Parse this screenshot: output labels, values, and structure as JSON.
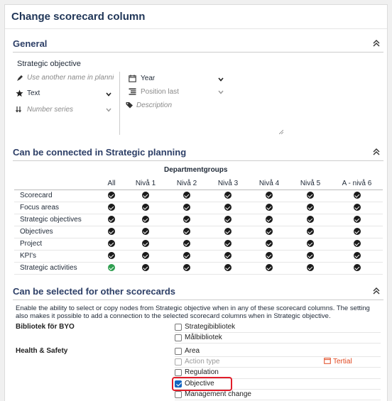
{
  "dialog": {
    "title": "Change scorecard column"
  },
  "general": {
    "heading": "General",
    "name_value": "Strategic objective",
    "alt_name_placeholder": "Use another name in planning",
    "type_value": "Text",
    "number_series_placeholder": "Number series",
    "period_value": "Year",
    "position_placeholder": "Position last",
    "description_placeholder": "Description"
  },
  "connect": {
    "heading": "Can be connected in Strategic planning",
    "group_header": "Departmentgroups",
    "columns": [
      "All",
      "Nivå 1",
      "Nivå 2",
      "Nivå 3",
      "Nivå 4",
      "Nivå 5",
      "A - nivå 6"
    ],
    "rows": [
      {
        "label": "Scorecard",
        "all_green": false
      },
      {
        "label": "Focus areas",
        "all_green": false
      },
      {
        "label": "Strategic objectives",
        "all_green": false
      },
      {
        "label": "Objectives",
        "all_green": false
      },
      {
        "label": "Project",
        "all_green": false
      },
      {
        "label": "KPI's",
        "all_green": false
      },
      {
        "label": "Strategic activities",
        "all_green": true
      }
    ]
  },
  "select": {
    "heading": "Can be selected for other scorecards",
    "description": "Enable the ability to select or copy nodes from Strategic objective when in any of these scorecard columns. The setting also makes it possible to add a connection to the selected scorecard columns when in Strategic objective.",
    "groups": [
      {
        "label": "Bibliotek för BYO",
        "items": [
          {
            "label": "Strategibibliotek",
            "checked": false,
            "disabled": false
          },
          {
            "label": "Målbibliotek",
            "checked": false,
            "disabled": false
          }
        ]
      },
      {
        "label": "Health & Safety",
        "items": [
          {
            "label": "Area",
            "checked": false,
            "disabled": false
          },
          {
            "label": "Action type",
            "checked": false,
            "disabled": true,
            "tag": "Tertial"
          },
          {
            "label": "Regulation",
            "checked": false,
            "disabled": false
          },
          {
            "label": "Objective",
            "checked": true,
            "disabled": false,
            "highlighted": true
          },
          {
            "label": "Management change",
            "checked": false,
            "disabled": false
          }
        ]
      }
    ]
  },
  "colors": {
    "heading": "#2c3e66",
    "accent": "#1565c0",
    "highlight": "#e11d2a",
    "tag": "#e0471f",
    "green": "#2e9e4f"
  }
}
